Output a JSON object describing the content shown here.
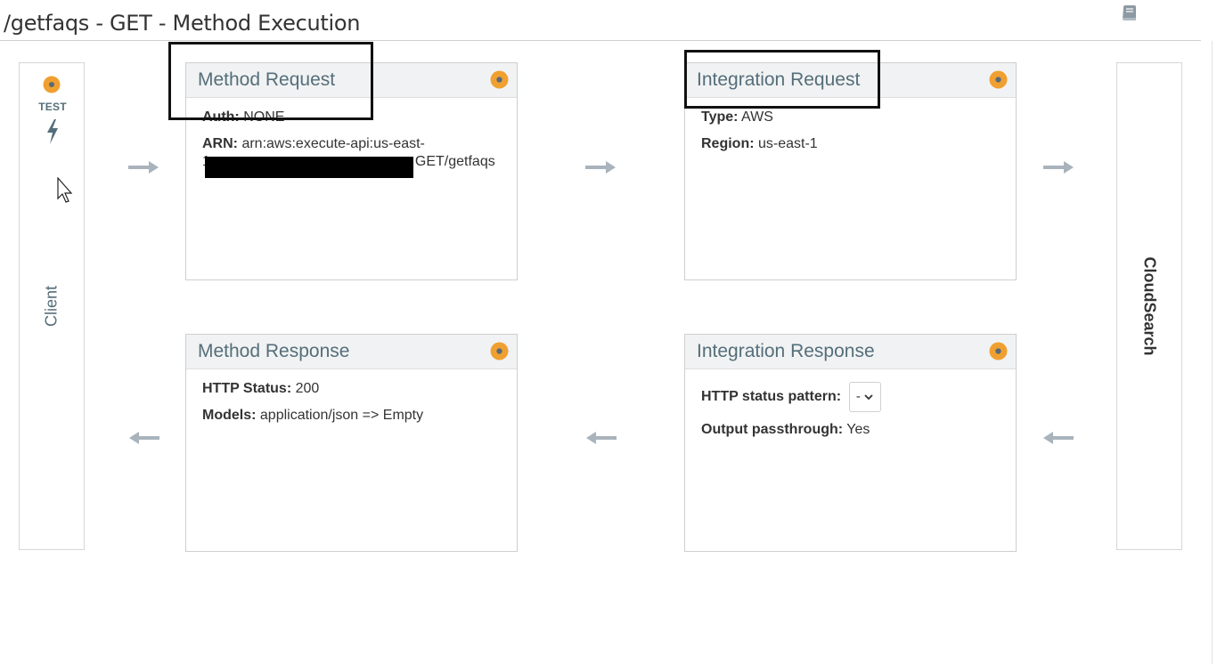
{
  "header": {
    "title": "/getfaqs - GET - Method Execution",
    "docs_icon": "book-icon"
  },
  "client": {
    "test_label": "TEST",
    "label": "Client"
  },
  "backend": {
    "label": "CloudSearch"
  },
  "method_request": {
    "title": "Method Request",
    "auth_label": "Auth:",
    "auth_value": "NONE",
    "arn_label": "ARN:",
    "arn_value_line1": "arn:aws:execute-api:us-east-",
    "arn_value_line1b": "1",
    "arn_value_tail": "GET/getfaqs"
  },
  "integration_request": {
    "title": "Integration Request",
    "type_label": "Type:",
    "type_value": "AWS",
    "region_label": "Region:",
    "region_value": "us-east-1"
  },
  "method_response": {
    "title": "Method Response",
    "status_label": "HTTP Status:",
    "status_value": "200",
    "models_label": "Models:",
    "models_value": "application/json => Empty"
  },
  "integration_response": {
    "title": "Integration Response",
    "pattern_label": "HTTP status pattern:",
    "pattern_value": "-",
    "passthrough_label": "Output passthrough:",
    "passthrough_value": "Yes"
  },
  "colors": {
    "accent_orange": "#f0a030",
    "title_blue_gray": "#546e7a",
    "arrow_gray": "#a9b3bc"
  }
}
